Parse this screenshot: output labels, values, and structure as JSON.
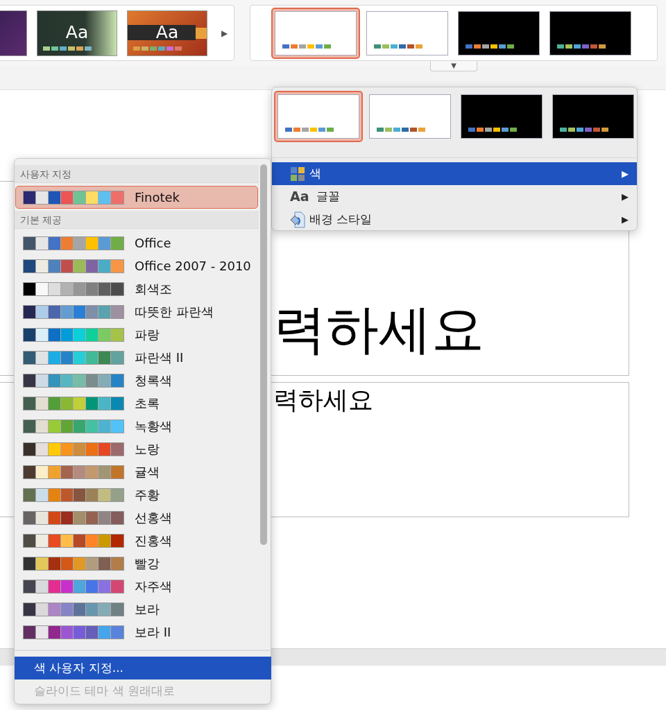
{
  "ribbon": {
    "themes": [
      {
        "kind": "cut"
      },
      {
        "kind": "green",
        "text": "Aa",
        "swatches": [
          {
            "color": "#a9d18e"
          },
          {
            "color": "#71c49a"
          },
          {
            "color": "#5fb1c9"
          },
          {
            "color": "#c9c16a"
          },
          {
            "color": "#d9a559"
          },
          {
            "color": "#7bb5c2"
          }
        ]
      },
      {
        "kind": "orange",
        "text": "Aa",
        "swatches": [
          {
            "color": "#d9a046"
          },
          {
            "color": "#c7b46b"
          },
          {
            "color": "#7fae6a"
          },
          {
            "color": "#5eaac1"
          },
          {
            "color": "#c470d8"
          },
          {
            "color": "#e0786a"
          }
        ]
      }
    ],
    "more_arrow": "▶",
    "variants": [
      {
        "selected": true,
        "dark": false,
        "swatches": [
          {
            "color": "#4472c4"
          },
          {
            "color": "#ed7d31"
          },
          {
            "color": "#a5a5a5"
          },
          {
            "color": "#ffc000"
          },
          {
            "color": "#5b9bd5"
          },
          {
            "color": "#70ad47"
          }
        ]
      },
      {
        "selected": false,
        "dark": false,
        "swatches": [
          {
            "color": "#40917a"
          },
          {
            "color": "#9bbf5a"
          },
          {
            "color": "#4eaed1"
          },
          {
            "color": "#2f6aa8"
          },
          {
            "color": "#b0542a"
          },
          {
            "color": "#e9a23b"
          }
        ]
      },
      {
        "selected": false,
        "dark": true,
        "swatches": [
          {
            "color": "#4472c4"
          },
          {
            "color": "#ed7d31"
          },
          {
            "color": "#a5a5a5"
          },
          {
            "color": "#ffc000"
          },
          {
            "color": "#5b9bd5"
          },
          {
            "color": "#70ad47"
          }
        ]
      },
      {
        "selected": false,
        "dark": true,
        "swatches": [
          {
            "color": "#4ab39b"
          },
          {
            "color": "#a3c25c"
          },
          {
            "color": "#4ea5d6"
          },
          {
            "color": "#7e62c9"
          },
          {
            "color": "#c2573a"
          },
          {
            "color": "#d19a3d"
          }
        ]
      }
    ],
    "dropdown_arrow": "▼"
  },
  "slide": {
    "title": "력하세요",
    "subtitle": "력하세요"
  },
  "variants_menu": {
    "variants": [
      {
        "selected": true,
        "dark": false,
        "swatches": [
          {
            "color": "#4472c4"
          },
          {
            "color": "#ed7d31"
          },
          {
            "color": "#a5a5a5"
          },
          {
            "color": "#ffc000"
          },
          {
            "color": "#5b9bd5"
          },
          {
            "color": "#70ad47"
          }
        ]
      },
      {
        "selected": false,
        "dark": false,
        "swatches": [
          {
            "color": "#40917a"
          },
          {
            "color": "#9bbf5a"
          },
          {
            "color": "#4eaed1"
          },
          {
            "color": "#2f6aa8"
          },
          {
            "color": "#b0542a"
          },
          {
            "color": "#e9a23b"
          }
        ]
      },
      {
        "selected": false,
        "dark": true,
        "swatches": [
          {
            "color": "#4472c4"
          },
          {
            "color": "#ed7d31"
          },
          {
            "color": "#a5a5a5"
          },
          {
            "color": "#ffc000"
          },
          {
            "color": "#5b9bd5"
          },
          {
            "color": "#70ad47"
          }
        ]
      },
      {
        "selected": false,
        "dark": true,
        "swatches": [
          {
            "color": "#4ab39b"
          },
          {
            "color": "#a3c25c"
          },
          {
            "color": "#4ea5d6"
          },
          {
            "color": "#7e62c9"
          },
          {
            "color": "#c2573a"
          },
          {
            "color": "#d19a3d"
          }
        ]
      }
    ],
    "items": [
      {
        "kind": "colors",
        "label": "색",
        "selected": true,
        "arrow": "▶"
      },
      {
        "kind": "fonts",
        "icon_text": "Aa",
        "label": "글꼴",
        "selected": false,
        "arrow": "▶"
      },
      {
        "kind": "background",
        "label": "배경 스타일",
        "selected": false,
        "arrow": "▶"
      }
    ]
  },
  "colors_menu": {
    "sections": [
      {
        "header": "사용자 지정",
        "items": [
          {
            "name": "Finotek",
            "selected": true,
            "swatches": [
              {
                "color": "#2b2a72"
              },
              {
                "color": "#e7e6e6"
              },
              {
                "color": "#1f56b6"
              },
              {
                "color": "#ec5556"
              },
              {
                "color": "#6fc394"
              },
              {
                "color": "#fddd63"
              },
              {
                "color": "#5ec0ef"
              },
              {
                "color": "#ee6e6a"
              }
            ]
          }
        ]
      },
      {
        "header": "기본 제공",
        "items": [
          {
            "name": "Office",
            "selected": false,
            "swatches": [
              {
                "color": "#44546a"
              },
              {
                "color": "#e7e6e6"
              },
              {
                "color": "#4472c4"
              },
              {
                "color": "#ed7d31"
              },
              {
                "color": "#a5a5a5"
              },
              {
                "color": "#ffc000"
              },
              {
                "color": "#5b9bd5"
              },
              {
                "color": "#70ad47"
              }
            ]
          },
          {
            "name": "Office 2007 - 2010",
            "selected": false,
            "swatches": [
              {
                "color": "#1f497d"
              },
              {
                "color": "#eeece1"
              },
              {
                "color": "#4f81bd"
              },
              {
                "color": "#c0504d"
              },
              {
                "color": "#9bbb59"
              },
              {
                "color": "#8064a2"
              },
              {
                "color": "#4bacc6"
              },
              {
                "color": "#f79646"
              }
            ]
          },
          {
            "name": "회색조",
            "selected": false,
            "swatches": [
              {
                "color": "#000000"
              },
              {
                "color": "#f8f8f8"
              },
              {
                "color": "#dddddd"
              },
              {
                "color": "#b2b2b2"
              },
              {
                "color": "#969696"
              },
              {
                "color": "#808080"
              },
              {
                "color": "#5f5f5f"
              },
              {
                "color": "#4d4d4d"
              }
            ]
          },
          {
            "name": "따뜻한 파란색",
            "selected": false,
            "swatches": [
              {
                "color": "#242852"
              },
              {
                "color": "#acccea"
              },
              {
                "color": "#4a66ac"
              },
              {
                "color": "#629dd1"
              },
              {
                "color": "#297fd5"
              },
              {
                "color": "#7f8fa9"
              },
              {
                "color": "#5aa2ae"
              },
              {
                "color": "#9d90a0"
              }
            ]
          },
          {
            "name": "파랑",
            "selected": false,
            "swatches": [
              {
                "color": "#17406d"
              },
              {
                "color": "#dbeff9"
              },
              {
                "color": "#0f6fc6"
              },
              {
                "color": "#009dd9"
              },
              {
                "color": "#0bd0d9"
              },
              {
                "color": "#10cf9b"
              },
              {
                "color": "#7cca62"
              },
              {
                "color": "#a5c249"
              }
            ]
          },
          {
            "name": "파란색 II",
            "selected": false,
            "swatches": [
              {
                "color": "#335b74"
              },
              {
                "color": "#dfe3e5"
              },
              {
                "color": "#1cade4"
              },
              {
                "color": "#2683c6"
              },
              {
                "color": "#27ced7"
              },
              {
                "color": "#42ba97"
              },
              {
                "color": "#3e8853"
              },
              {
                "color": "#62a39f"
              }
            ]
          },
          {
            "name": "청록색",
            "selected": false,
            "swatches": [
              {
                "color": "#373545"
              },
              {
                "color": "#cedbe6"
              },
              {
                "color": "#3494ba"
              },
              {
                "color": "#58b6c0"
              },
              {
                "color": "#75bda7"
              },
              {
                "color": "#7a8c8e"
              },
              {
                "color": "#84acb6"
              },
              {
                "color": "#2683c6"
              }
            ]
          },
          {
            "name": "초록",
            "selected": false,
            "swatches": [
              {
                "color": "#455f51"
              },
              {
                "color": "#e3ded1"
              },
              {
                "color": "#549e39"
              },
              {
                "color": "#8ab833"
              },
              {
                "color": "#c0cf3a"
              },
              {
                "color": "#029676"
              },
              {
                "color": "#4ab5c4"
              },
              {
                "color": "#0989b1"
              }
            ]
          },
          {
            "name": "녹황색",
            "selected": false,
            "swatches": [
              {
                "color": "#455f51"
              },
              {
                "color": "#e3ded1"
              },
              {
                "color": "#99cb38"
              },
              {
                "color": "#63a537"
              },
              {
                "color": "#37a76f"
              },
              {
                "color": "#44c1a3"
              },
              {
                "color": "#4eb3cf"
              },
              {
                "color": "#51c3f9"
              }
            ]
          },
          {
            "name": "노랑",
            "selected": false,
            "swatches": [
              {
                "color": "#39302a"
              },
              {
                "color": "#e5dedb"
              },
              {
                "color": "#ffca08"
              },
              {
                "color": "#f8931d"
              },
              {
                "color": "#ce8d3e"
              },
              {
                "color": "#ec7016"
              },
              {
                "color": "#e64823"
              },
              {
                "color": "#9c6a6a"
              }
            ]
          },
          {
            "name": "귤색",
            "selected": false,
            "swatches": [
              {
                "color": "#4e3b30"
              },
              {
                "color": "#fbeec9"
              },
              {
                "color": "#f0a22e"
              },
              {
                "color": "#a5644e"
              },
              {
                "color": "#b58b80"
              },
              {
                "color": "#c3986d"
              },
              {
                "color": "#a19574"
              },
              {
                "color": "#c17529"
              }
            ]
          },
          {
            "name": "주황",
            "selected": false,
            "swatches": [
              {
                "color": "#637052"
              },
              {
                "color": "#ccddea"
              },
              {
                "color": "#e48312"
              },
              {
                "color": "#bd582c"
              },
              {
                "color": "#865640"
              },
              {
                "color": "#9b8357"
              },
              {
                "color": "#c2bc80"
              },
              {
                "color": "#94a088"
              }
            ]
          },
          {
            "name": "선홍색",
            "selected": false,
            "swatches": [
              {
                "color": "#696464"
              },
              {
                "color": "#e9e5dc"
              },
              {
                "color": "#d34817"
              },
              {
                "color": "#9b2d1f"
              },
              {
                "color": "#a28e6a"
              },
              {
                "color": "#956251"
              },
              {
                "color": "#918485"
              },
              {
                "color": "#855d5d"
              }
            ]
          },
          {
            "name": "진홍색",
            "selected": false,
            "swatches": [
              {
                "color": "#4f4c45"
              },
              {
                "color": "#eeece1"
              },
              {
                "color": "#e84c22"
              },
              {
                "color": "#ffbd47"
              },
              {
                "color": "#b64926"
              },
              {
                "color": "#ff8427"
              },
              {
                "color": "#cc9900"
              },
              {
                "color": "#b22600"
              }
            ]
          },
          {
            "name": "빨강",
            "selected": false,
            "swatches": [
              {
                "color": "#323232"
              },
              {
                "color": "#e3c75a"
              },
              {
                "color": "#a5300f"
              },
              {
                "color": "#d55816"
              },
              {
                "color": "#e19825"
              },
              {
                "color": "#b19c7d"
              },
              {
                "color": "#7f5f52"
              },
              {
                "color": "#b27d49"
              }
            ]
          },
          {
            "name": "자주색",
            "selected": false,
            "swatches": [
              {
                "color": "#454551"
              },
              {
                "color": "#d8d9dc"
              },
              {
                "color": "#e32d91"
              },
              {
                "color": "#c830cc"
              },
              {
                "color": "#4ea6dc"
              },
              {
                "color": "#4775e7"
              },
              {
                "color": "#8971e1"
              },
              {
                "color": "#d54773"
              }
            ]
          },
          {
            "name": "보라",
            "selected": false,
            "swatches": [
              {
                "color": "#373545"
              },
              {
                "color": "#dcd8dc"
              },
              {
                "color": "#ad84c6"
              },
              {
                "color": "#8784c7"
              },
              {
                "color": "#5d739a"
              },
              {
                "color": "#6997af"
              },
              {
                "color": "#84acb6"
              },
              {
                "color": "#6f8183"
              }
            ]
          },
          {
            "name": "보라 II",
            "selected": false,
            "swatches": [
              {
                "color": "#632e62"
              },
              {
                "color": "#eae5eb"
              },
              {
                "color": "#92278f"
              },
              {
                "color": "#9b57d3"
              },
              {
                "color": "#755dd9"
              },
              {
                "color": "#665eb8"
              },
              {
                "color": "#45a5ed"
              },
              {
                "color": "#5982db"
              }
            ]
          }
        ]
      }
    ],
    "actions": [
      {
        "label": "색 사용자 지정...",
        "selected": true,
        "disabled": false
      },
      {
        "label": "슬라이드 테마 색 원래대로",
        "selected": false,
        "disabled": true
      }
    ]
  }
}
